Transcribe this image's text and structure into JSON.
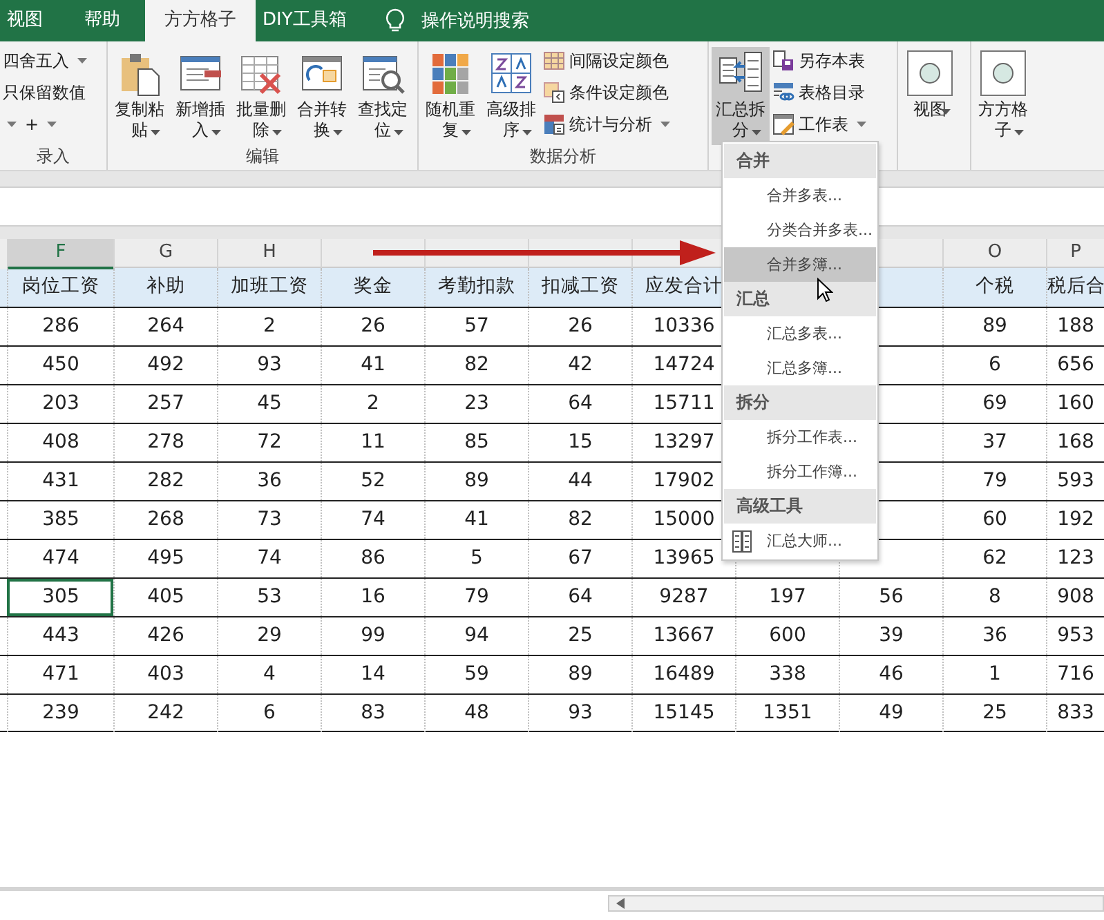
{
  "tabs": [
    {
      "label": "视图",
      "selected": false
    },
    {
      "label": "帮助",
      "selected": false
    },
    {
      "label": "方方格子",
      "selected": true
    },
    {
      "label": "DIY工具箱",
      "selected": false
    }
  ],
  "search": {
    "label": "操作说明搜索"
  },
  "ribbon": {
    "groups": [
      {
        "label": "录入",
        "small": [
          {
            "label": "四舍五入",
            "dropdown": true
          },
          {
            "label": "只保留数值",
            "dropdown": false
          },
          {
            "label": "+",
            "dropdown": true
          }
        ]
      },
      {
        "label": "编辑",
        "large": [
          {
            "label": "复制粘贴",
            "dropdown": true,
            "pressed": false
          },
          {
            "label": "新增插入",
            "dropdown": true,
            "pressed": false
          },
          {
            "label": "批量删除",
            "dropdown": true,
            "pressed": false
          },
          {
            "label": "合并转换",
            "dropdown": true,
            "pressed": false
          },
          {
            "label": "查找定位",
            "dropdown": true,
            "pressed": false
          }
        ]
      },
      {
        "label": "数据分析",
        "large": [
          {
            "label": "随机重复",
            "dropdown": true,
            "pressed": false
          },
          {
            "label": "高级排序",
            "dropdown": true,
            "pressed": false
          }
        ],
        "small": [
          {
            "label": "间隔设定颜色",
            "dropdown": false
          },
          {
            "label": "条件设定颜色",
            "dropdown": false
          },
          {
            "label": "统计与分析",
            "dropdown": true
          }
        ]
      },
      {
        "large": [
          {
            "label": "汇总拆分",
            "dropdown": true,
            "pressed": true
          }
        ],
        "small": [
          {
            "label": "另存本表",
            "dropdown": false
          },
          {
            "label": "表格目录",
            "dropdown": false
          },
          {
            "label": "工作表",
            "dropdown": true
          }
        ]
      },
      {
        "large": [
          {
            "label": "视图",
            "dropdown": true,
            "pressed": false
          }
        ]
      },
      {
        "large": [
          {
            "label": "方方格子",
            "dropdown": true,
            "pressed": false
          }
        ]
      }
    ]
  },
  "column_letters": [
    {
      "label": "F",
      "selected": true
    },
    {
      "label": "G",
      "selected": false
    },
    {
      "label": "H",
      "selected": false
    },
    {
      "label": "O",
      "selected": false
    },
    {
      "label": "P",
      "selected": false
    }
  ],
  "table": {
    "headers": [
      "岗位工资",
      "补助",
      "加班工资",
      "奖金",
      "考勤扣款",
      "扣减工资",
      "应发合计",
      "个税",
      "税后合"
    ],
    "rows": [
      {
        "selected": false,
        "values": [
          "286",
          "264",
          "2",
          "26",
          "57",
          "26",
          "10336",
          "89",
          "188"
        ]
      },
      {
        "selected": false,
        "values": [
          "450",
          "492",
          "93",
          "41",
          "82",
          "42",
          "14724",
          "6",
          "656"
        ]
      },
      {
        "selected": false,
        "values": [
          "203",
          "257",
          "45",
          "2",
          "23",
          "64",
          "15711",
          "69",
          "160"
        ]
      },
      {
        "selected": false,
        "values": [
          "408",
          "278",
          "72",
          "11",
          "85",
          "15",
          "13297",
          "37",
          "168"
        ]
      },
      {
        "selected": false,
        "values": [
          "431",
          "282",
          "36",
          "52",
          "89",
          "44",
          "17902",
          "79",
          "593"
        ]
      },
      {
        "selected": false,
        "values": [
          "385",
          "268",
          "73",
          "74",
          "41",
          "82",
          "15000",
          "60",
          "192"
        ]
      },
      {
        "selected": false,
        "values": [
          "474",
          "495",
          "74",
          "86",
          "5",
          "67",
          "13965",
          "62",
          "123"
        ]
      },
      {
        "selected": true,
        "values": [
          "305",
          "405",
          "53",
          "16",
          "79",
          "64",
          "9287",
          "197",
          "56",
          "8",
          "908"
        ]
      },
      {
        "selected": false,
        "values": [
          "443",
          "426",
          "29",
          "99",
          "94",
          "25",
          "13667",
          "600",
          "39",
          "36",
          "953"
        ]
      },
      {
        "selected": false,
        "values": [
          "471",
          "403",
          "4",
          "14",
          "59",
          "89",
          "16489",
          "338",
          "46",
          "1",
          "716"
        ]
      },
      {
        "selected": false,
        "values": [
          "239",
          "242",
          "6",
          "83",
          "48",
          "93",
          "15145",
          "1351",
          "49",
          "25",
          "833"
        ]
      }
    ]
  },
  "dropdown_menu": {
    "sections": [
      {
        "title": "合并",
        "items": [
          {
            "label": "合并多表...",
            "highlighted": false
          },
          {
            "label": "分类合并多表...",
            "highlighted": false
          },
          {
            "label": "合并多簿...",
            "highlighted": true
          }
        ]
      },
      {
        "title": "汇总",
        "items": [
          {
            "label": "汇总多表...",
            "highlighted": false
          },
          {
            "label": "汇总多簿...",
            "highlighted": false
          }
        ]
      },
      {
        "title": "拆分",
        "items": [
          {
            "label": "拆分工作表...",
            "highlighted": false
          },
          {
            "label": "拆分工作簿...",
            "highlighted": false
          }
        ]
      },
      {
        "title": "高级工具",
        "items": [
          {
            "label": "汇总大师...",
            "highlighted": false
          }
        ]
      }
    ]
  }
}
